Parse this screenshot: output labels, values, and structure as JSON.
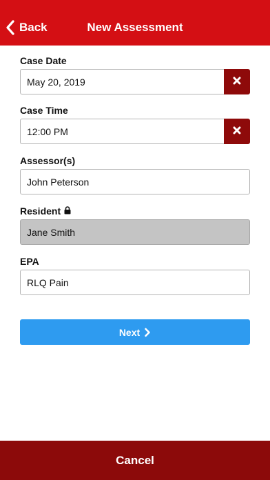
{
  "header": {
    "back_label": "Back",
    "title": "New Assessment",
    "background_color": "#d40f14"
  },
  "form": {
    "case_date": {
      "label": "Case Date",
      "value": "May 20, 2019",
      "clear_icon": "times-icon"
    },
    "case_time": {
      "label": "Case Time",
      "value": "12:00 PM",
      "clear_icon": "times-icon"
    },
    "assessors": {
      "label": "Assessor(s)",
      "value": "John Peterson"
    },
    "resident": {
      "label": "Resident",
      "value": "Jane Smith",
      "locked": true,
      "lock_icon": "lock-icon"
    },
    "epa": {
      "label": "EPA",
      "value": "RLQ Pain"
    }
  },
  "actions": {
    "next_label": "Next",
    "next_icon": "chevron-right-icon",
    "next_color": "#2e9bf0",
    "cancel_label": "Cancel",
    "cancel_color": "#8c0a0a"
  }
}
